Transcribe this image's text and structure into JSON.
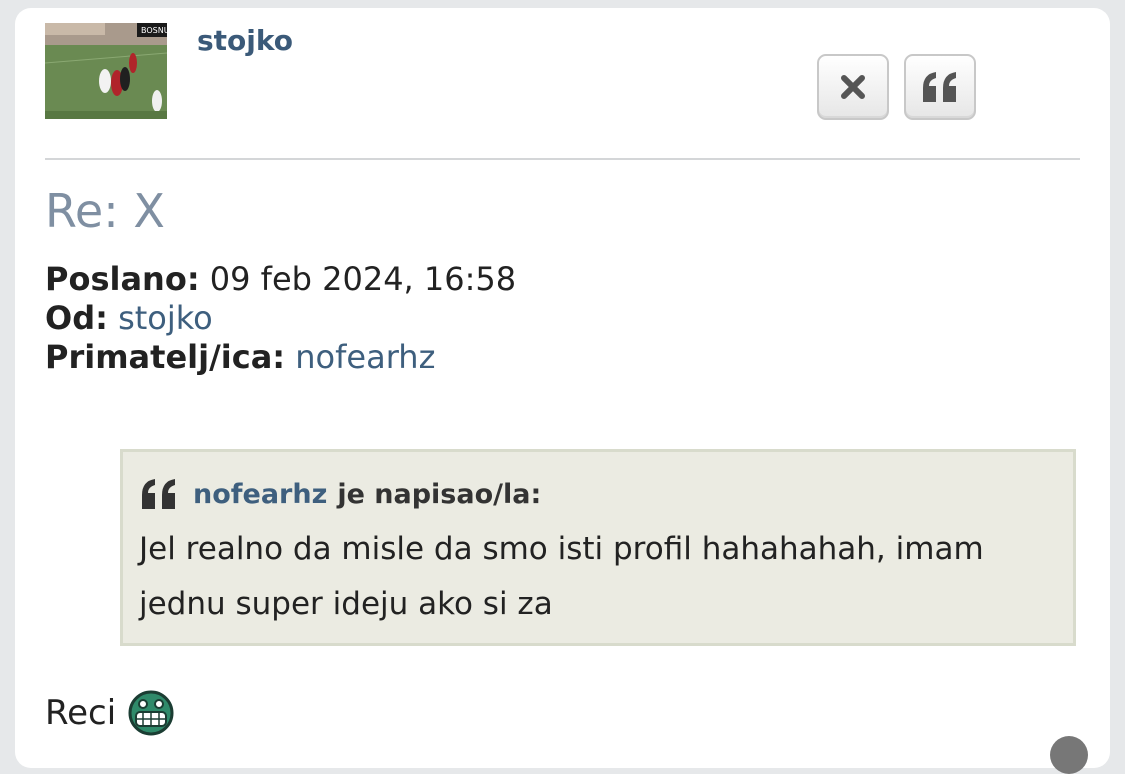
{
  "post": {
    "author": "stojko",
    "subject": "Re: X",
    "sent_label": "Poslano:",
    "sent_value": "09 feb 2024, 16:58",
    "from_label": "Od:",
    "from_value": "stojko",
    "to_label": "Primatelj/ica:",
    "to_value": "nofearhz",
    "body": "Reci"
  },
  "quote": {
    "author": "nofearhz",
    "wrote_label": "je napisao/la:",
    "line1": "Jel realno da misle da smo isti profil hahahahah, imam",
    "line2": "jednu super ideju ako si za"
  },
  "avatar": {
    "overlay_text": "BOSNU"
  },
  "actions": {
    "delete_icon": "close-icon",
    "quote_icon": "quote-icon"
  },
  "colors": {
    "link": "#3e5f7e",
    "subject": "#7f8fa2",
    "quote_bg": "#ebebe2"
  }
}
